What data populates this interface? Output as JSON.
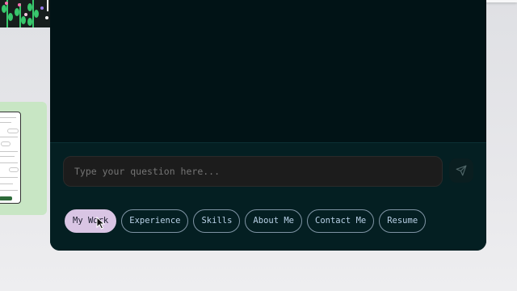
{
  "input": {
    "placeholder": "Type your question here..."
  },
  "send_icon": "paper-plane-icon",
  "chips": [
    {
      "label": "My Work",
      "active": true
    },
    {
      "label": "Experience",
      "active": false
    },
    {
      "label": "Skills",
      "active": false
    },
    {
      "label": "About Me",
      "active": false
    },
    {
      "label": "Contact Me",
      "active": false
    },
    {
      "label": "Resume",
      "active": false
    }
  ],
  "colors": {
    "panel_background": "#021315",
    "active_chip": "#d9c5e4",
    "chip_text": "#b8d0e6",
    "preview_card": "#c8e6c4"
  }
}
